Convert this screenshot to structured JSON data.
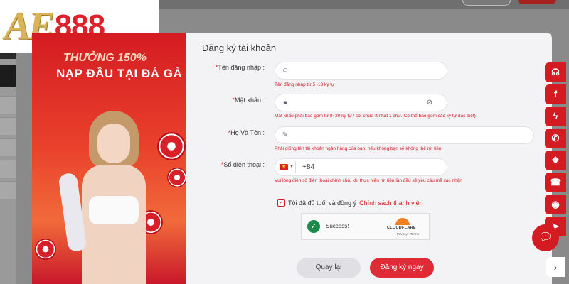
{
  "logo": {
    "ae": "AE",
    "number": "888"
  },
  "promo": {
    "line1": "THƯỞNG 150%",
    "line2": "NẠP ĐẦU TẠI ĐÁ GÀ"
  },
  "form": {
    "title": "Đăng ký tài khoản",
    "username": {
      "label": "Tên đăng nhập",
      "required": "*",
      "value": "",
      "hint": "Tên đăng nhập từ 5~13 ký tự"
    },
    "password": {
      "label": "Mật khẩu",
      "required": "*",
      "value": "",
      "hint": "Mật khẩu phải bao gồm từ 8~20 ký tự / số, chứa ít nhất 1 chữ.(Có thể bao gồm các ký tự đặc biệt)"
    },
    "fullname": {
      "label": "Họ Và Tên",
      "required": "*",
      "value": "",
      "hint": "Phải giống tên tài khoản ngân hàng của bạn, nếu không bạn sẽ không thể rút tiền"
    },
    "phone": {
      "label": "Số điện thoại",
      "required": "*",
      "prefix": "+84",
      "value": "",
      "hint": "Vui lòng điền số điện thoại chính chủ, khi thực hiện rút tiền lần đầu sẽ yêu cầu mã xác nhận"
    },
    "colon": ":",
    "agree": {
      "checked": true,
      "text": "Tôi đã đủ tuổi và đồng ý",
      "link": "Chính sách thành viên"
    },
    "captcha": {
      "status": "Success!",
      "brand": "CLOUDFLARE",
      "links": "Privacy • Terms"
    },
    "back_label": "Quay lại",
    "register_label": "Đăng ký ngay"
  },
  "social": [
    {
      "icon": "headset-icon"
    },
    {
      "icon": "facebook-icon"
    },
    {
      "icon": "messenger-icon"
    },
    {
      "icon": "whatsapp-icon"
    },
    {
      "icon": "wechat-icon"
    },
    {
      "icon": "phone-icon"
    },
    {
      "icon": "support-icon"
    },
    {
      "icon": "telegram-icon"
    }
  ],
  "colors": {
    "brand_red": "#d41b22",
    "logo_gold": "#d8b35a",
    "success_green": "#1b8a4a"
  }
}
